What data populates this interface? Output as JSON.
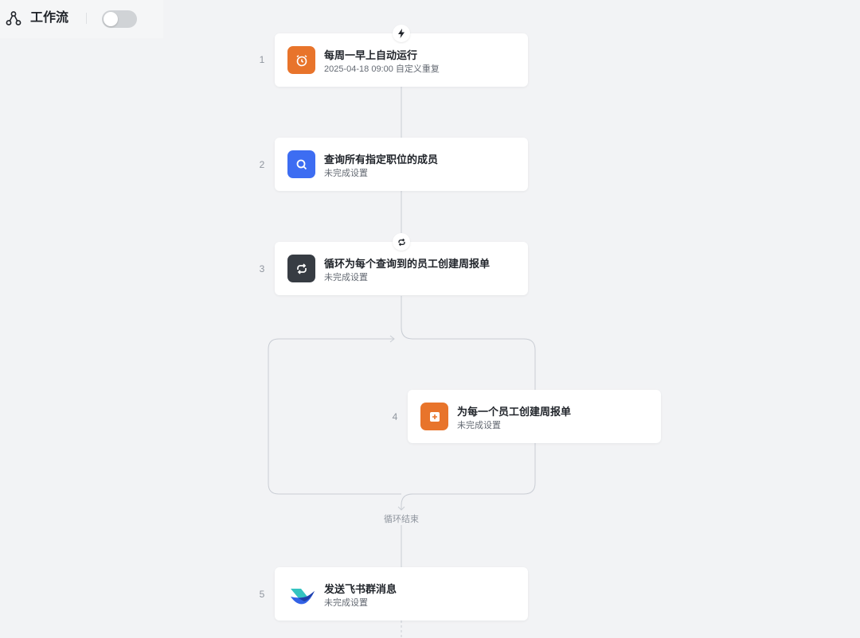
{
  "header": {
    "title": "工作流"
  },
  "steps": [
    {
      "num": "1",
      "title": "每周一早上自动运行",
      "subtitle": "2025-04-18 09:00 自定义重复"
    },
    {
      "num": "2",
      "title": "查询所有指定职位的成员",
      "subtitle": "未完成设置"
    },
    {
      "num": "3",
      "title": "循环为每个查询到的员工创建周报单",
      "subtitle": "未完成设置"
    },
    {
      "num": "4",
      "title": "为每一个员工创建周报单",
      "subtitle": "未完成设置"
    },
    {
      "num": "5",
      "title": "发送飞书群消息",
      "subtitle": "未完成设置"
    }
  ],
  "loop_end_label": "循环结束",
  "colors": {
    "orange": "#e8742b",
    "blue": "#3d6df2",
    "dark": "#373c43"
  }
}
